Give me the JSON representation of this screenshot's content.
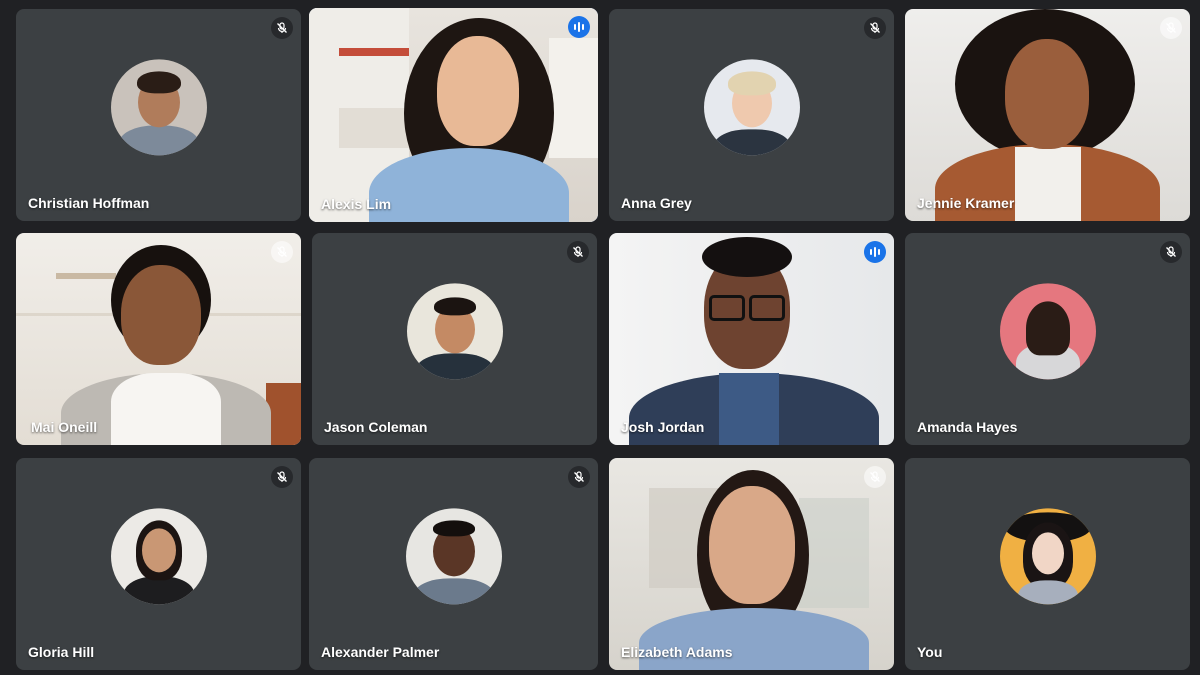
{
  "participants": [
    {
      "name": "Christian Hoffman",
      "status": "muted"
    },
    {
      "name": "Alexis Lim",
      "status": "speaking"
    },
    {
      "name": "Anna Grey",
      "status": "muted"
    },
    {
      "name": "Jennie Kramer",
      "status": "muted"
    },
    {
      "name": "Mai Oneill",
      "status": "muted"
    },
    {
      "name": "Jason Coleman",
      "status": "muted"
    },
    {
      "name": "Josh Jordan",
      "status": "speaking"
    },
    {
      "name": "Amanda Hayes",
      "status": "muted"
    },
    {
      "name": "Gloria Hill",
      "status": "muted"
    },
    {
      "name": "Alexander Palmer",
      "status": "muted"
    },
    {
      "name": "Elizabeth Adams",
      "status": "muted"
    },
    {
      "name": "You",
      "status": "none"
    }
  ],
  "icons": {
    "muted": "mic-off-icon",
    "speaking": "audio-level-icon"
  },
  "colors": {
    "background": "#202124",
    "tile": "#3c4043",
    "active_border": "#8ab4f8",
    "speaking_badge": "#1a73e8"
  }
}
